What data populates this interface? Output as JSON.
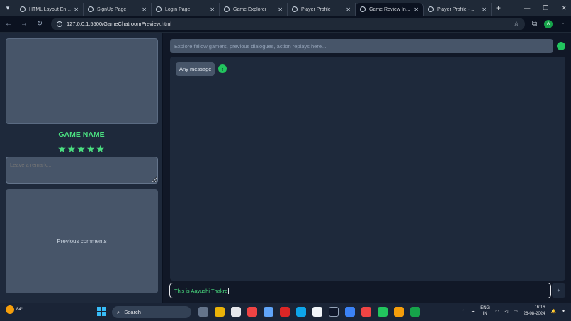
{
  "browser": {
    "tabs": [
      {
        "title": "HTML Layout Enhan",
        "active": false
      },
      {
        "title": "SignUp Page",
        "active": false
      },
      {
        "title": "Login Page",
        "active": false
      },
      {
        "title": "Game Explorer",
        "active": false
      },
      {
        "title": "Player Profile",
        "active": false
      },
      {
        "title": "Game Review Interfa",
        "active": true
      },
      {
        "title": "Player Profile - Read",
        "active": false
      }
    ],
    "url": "127.0.0.1:5500/GameChatroomPreview.html",
    "profile_initial": "A"
  },
  "left_panel": {
    "game_name": "GAME NAME",
    "stars": "★★★★★",
    "rating": 5,
    "remark_placeholder": "Leave a remark...",
    "previous_comments_label": "Previous comments"
  },
  "chat": {
    "search_placeholder": "Explore fellow gamers, previous dialogues, action replays here...",
    "messages": [
      {
        "text": "Any message"
      }
    ],
    "composer_value": "This is Aayushi Thakre",
    "send_label": "+"
  },
  "taskbar": {
    "temperature": "84°",
    "search_label": "Search",
    "lang_line1": "ENG",
    "lang_line2": "IN",
    "time": "16:16",
    "date": "26-08-2024"
  },
  "colors": {
    "accent_green": "#4ade80",
    "status_green": "#22c55e",
    "panel_gray": "#475569",
    "background": "#111827"
  }
}
